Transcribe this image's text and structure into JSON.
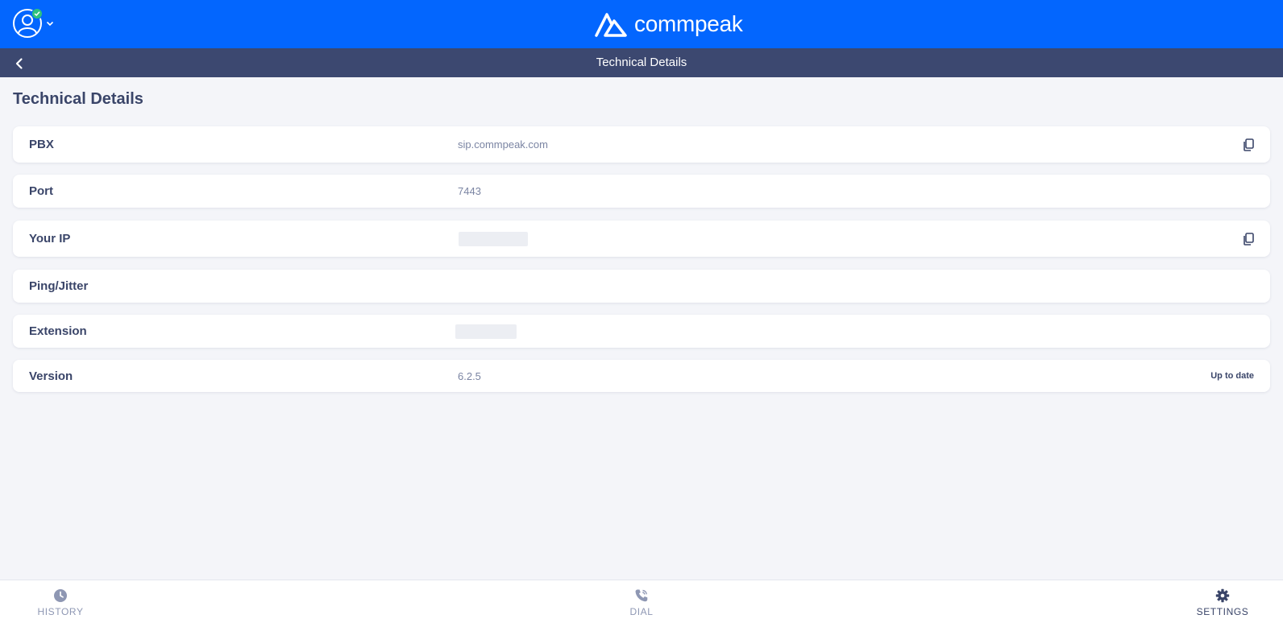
{
  "header": {
    "brand_name": "commpeak",
    "brand_color": "#0366fe",
    "status_color": "#2ec27e"
  },
  "subheader": {
    "title": "Technical Details",
    "background": "#3c4870"
  },
  "page": {
    "title": "Technical Details"
  },
  "rows": [
    {
      "label": "PBX",
      "value": "sip.commpeak.com",
      "action_icon": "copy-icon"
    },
    {
      "label": "Port",
      "value": "7443"
    },
    {
      "label": "Your IP",
      "value": "",
      "value_redacted": true,
      "action_icon": "copy-icon"
    },
    {
      "label": "Ping/Jitter",
      "value": ""
    },
    {
      "label": "Extension",
      "value": "",
      "value_redacted": true
    },
    {
      "label": "Version",
      "value": "6.2.5",
      "status": "Up to date"
    }
  ],
  "bottom_nav": {
    "items": [
      {
        "label": "HISTORY",
        "icon": "clock-icon",
        "active": false
      },
      {
        "label": "DIAL",
        "icon": "phone-icon",
        "active": false
      },
      {
        "label": "SETTINGS",
        "icon": "gear-icon",
        "active": true
      }
    ]
  }
}
